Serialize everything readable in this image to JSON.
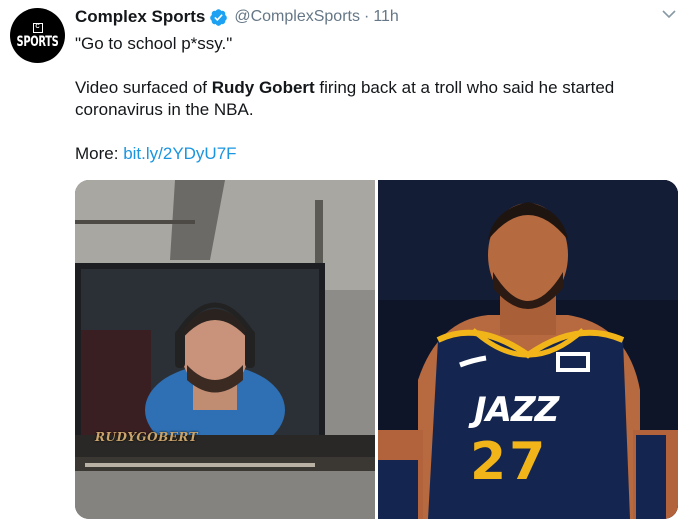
{
  "tweet": {
    "avatar": {
      "logo_text": "SPORTS",
      "logo_mark": "C"
    },
    "display_name": "Complex Sports",
    "handle": "@ComplexSports",
    "separator": "·",
    "time": "11h",
    "text": {
      "line1": "\"Go to school p*ssy.\"",
      "line2_before": "Video surfaced of ",
      "line2_bold": "Rudy Gobert",
      "line2_after": " firing back at a troll who said he started coronavirus in the NBA.",
      "more_label": "More: ",
      "link": "bit.ly/2YDyU7F"
    },
    "media": {
      "left": {
        "nameplate": "RUDYGOBERT"
      },
      "right": {
        "jersey_word": "JAZZ",
        "jersey_number": "27"
      }
    }
  },
  "colors": {
    "link": "#1b95e0",
    "verified": "#1da1f2",
    "muted": "#657786",
    "jazz_navy": "#0f1f44",
    "jazz_gold": "#f2b519"
  },
  "icons": [
    "complex-sports-logo-icon",
    "verified-badge-icon",
    "chevron-down-icon"
  ]
}
